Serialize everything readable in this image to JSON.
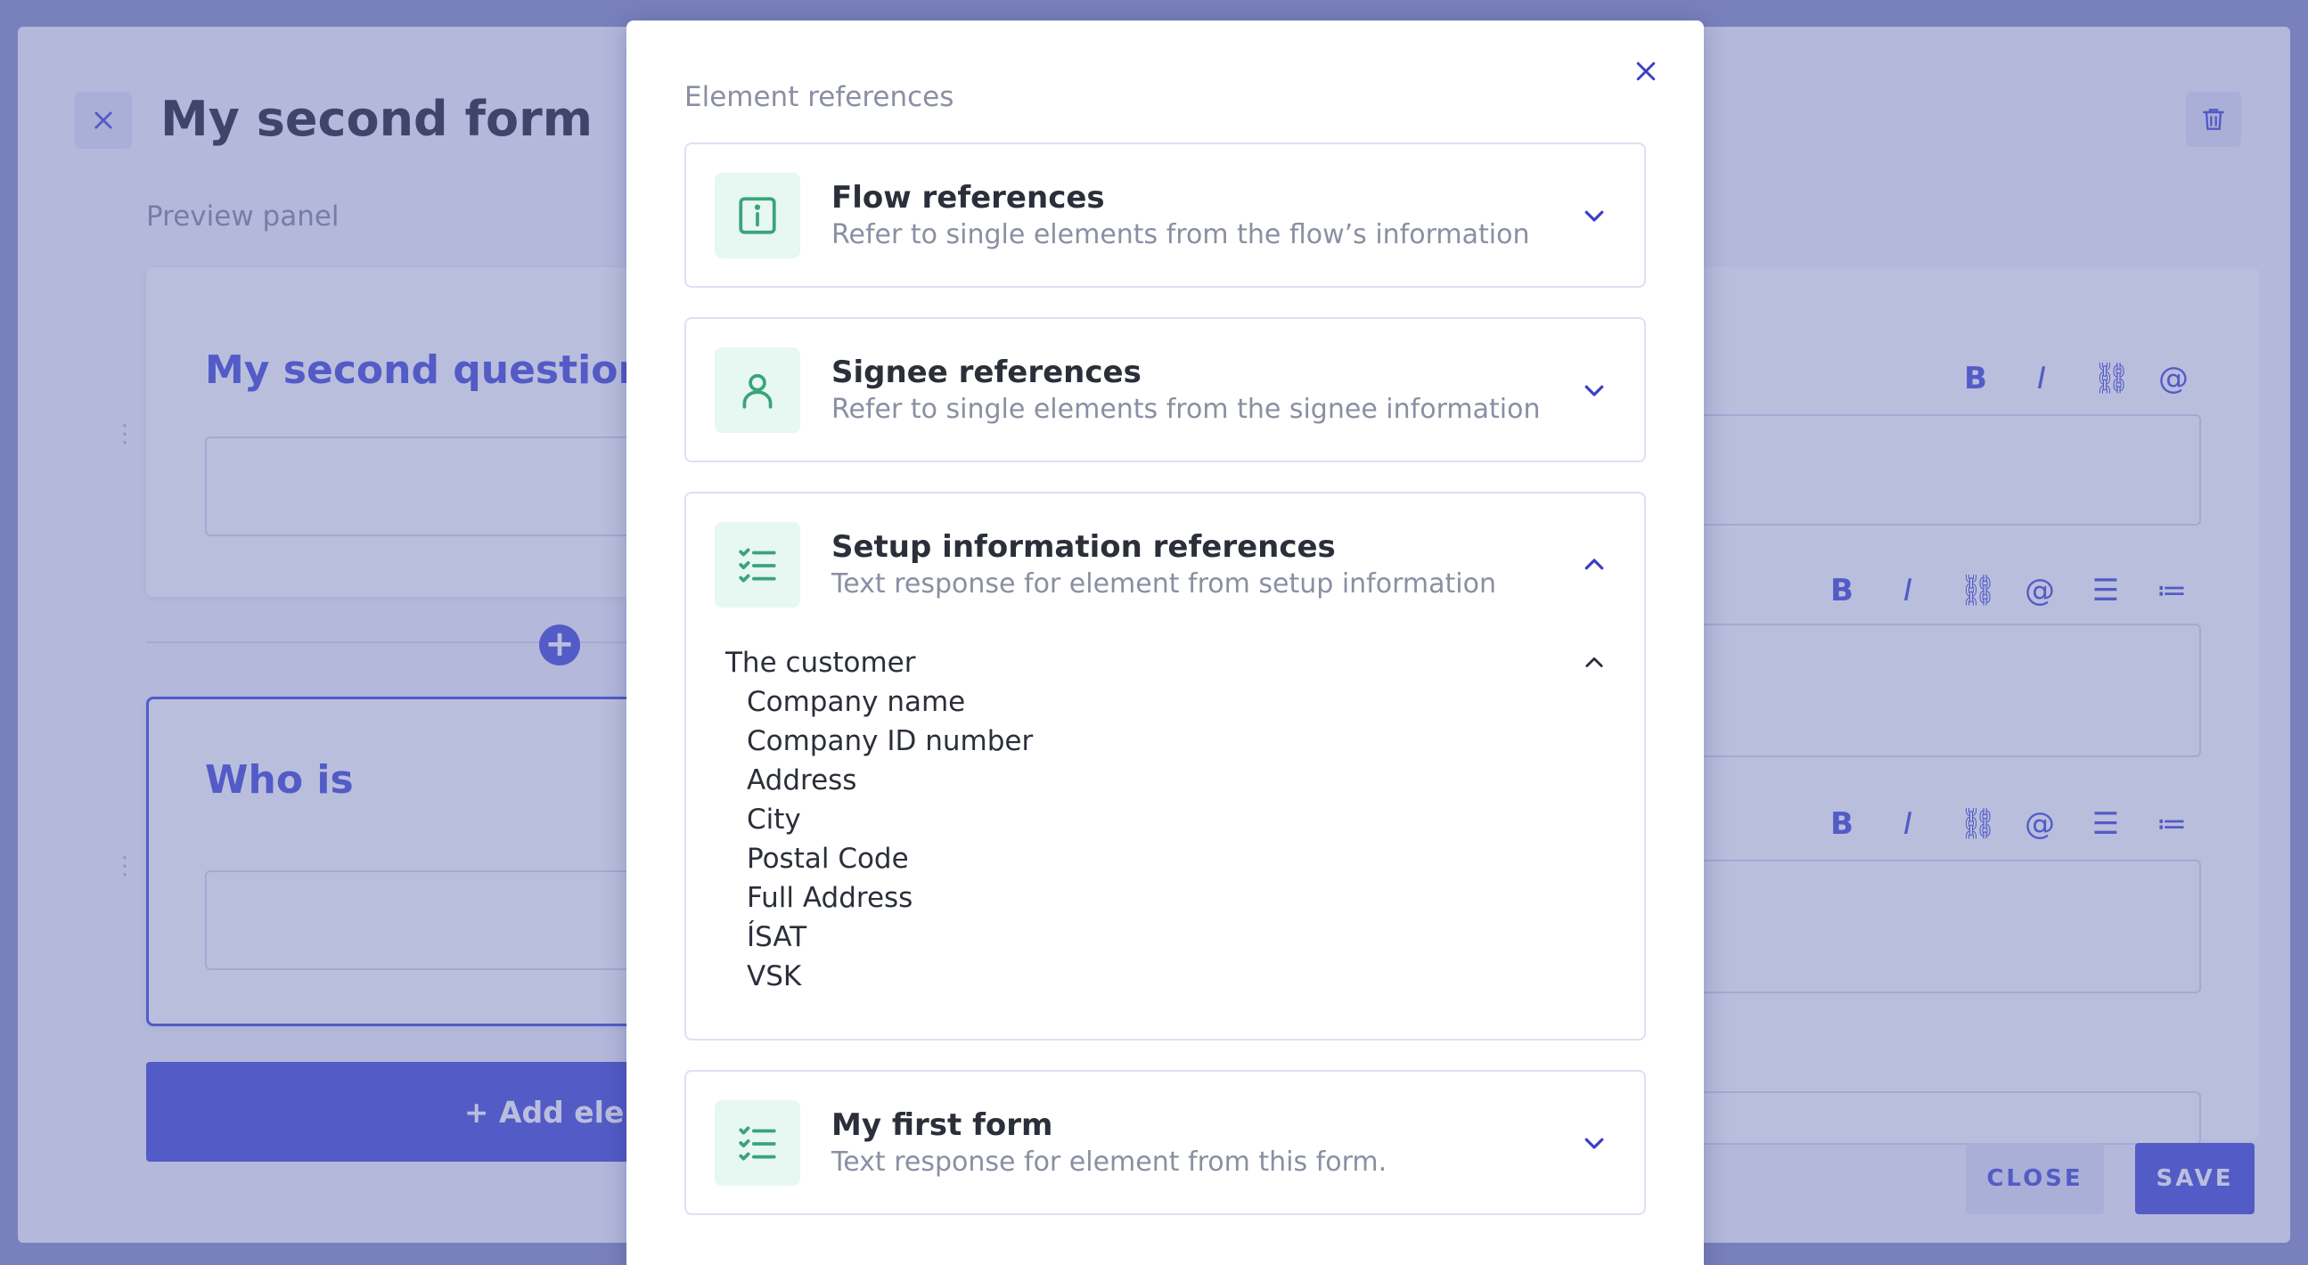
{
  "editor": {
    "title": "My second form",
    "preview_label": "Preview panel",
    "question1_title": "My second question",
    "question2_title": "Who is",
    "add_element_label": "+ Add eleme",
    "close_label": "CLOSE",
    "save_label": "SAVE",
    "format_buttons": [
      "B",
      "I",
      "link",
      "@",
      "bullet-list",
      "numbered-list"
    ]
  },
  "modal": {
    "heading": "Element references",
    "cards": [
      {
        "title": "Flow references",
        "subtitle": "Refer to single elements from the flow’s information",
        "icon": "info-icon",
        "expanded": false
      },
      {
        "title": "Signee references",
        "subtitle": "Refer to single elements from the signee information",
        "icon": "person-icon",
        "expanded": false
      },
      {
        "title": "Setup information references",
        "subtitle": "Text response for element from setup information",
        "icon": "checklist-icon",
        "expanded": true,
        "group_label": "The customer",
        "items": [
          "Company name",
          "Company ID number",
          "Address",
          "City",
          "Postal Code",
          "Full Address",
          "ÍSAT",
          "VSK"
        ]
      },
      {
        "title": "My first form",
        "subtitle": "Text response for element from this form.",
        "icon": "checklist-icon",
        "expanded": false
      }
    ]
  },
  "colors": {
    "accent": "#4e55d8",
    "icon_green": "#3aa47a",
    "icon_bg": "#e7f7f1",
    "muted_text": "#8a8fa3",
    "dark_text": "#2b2f3a"
  }
}
